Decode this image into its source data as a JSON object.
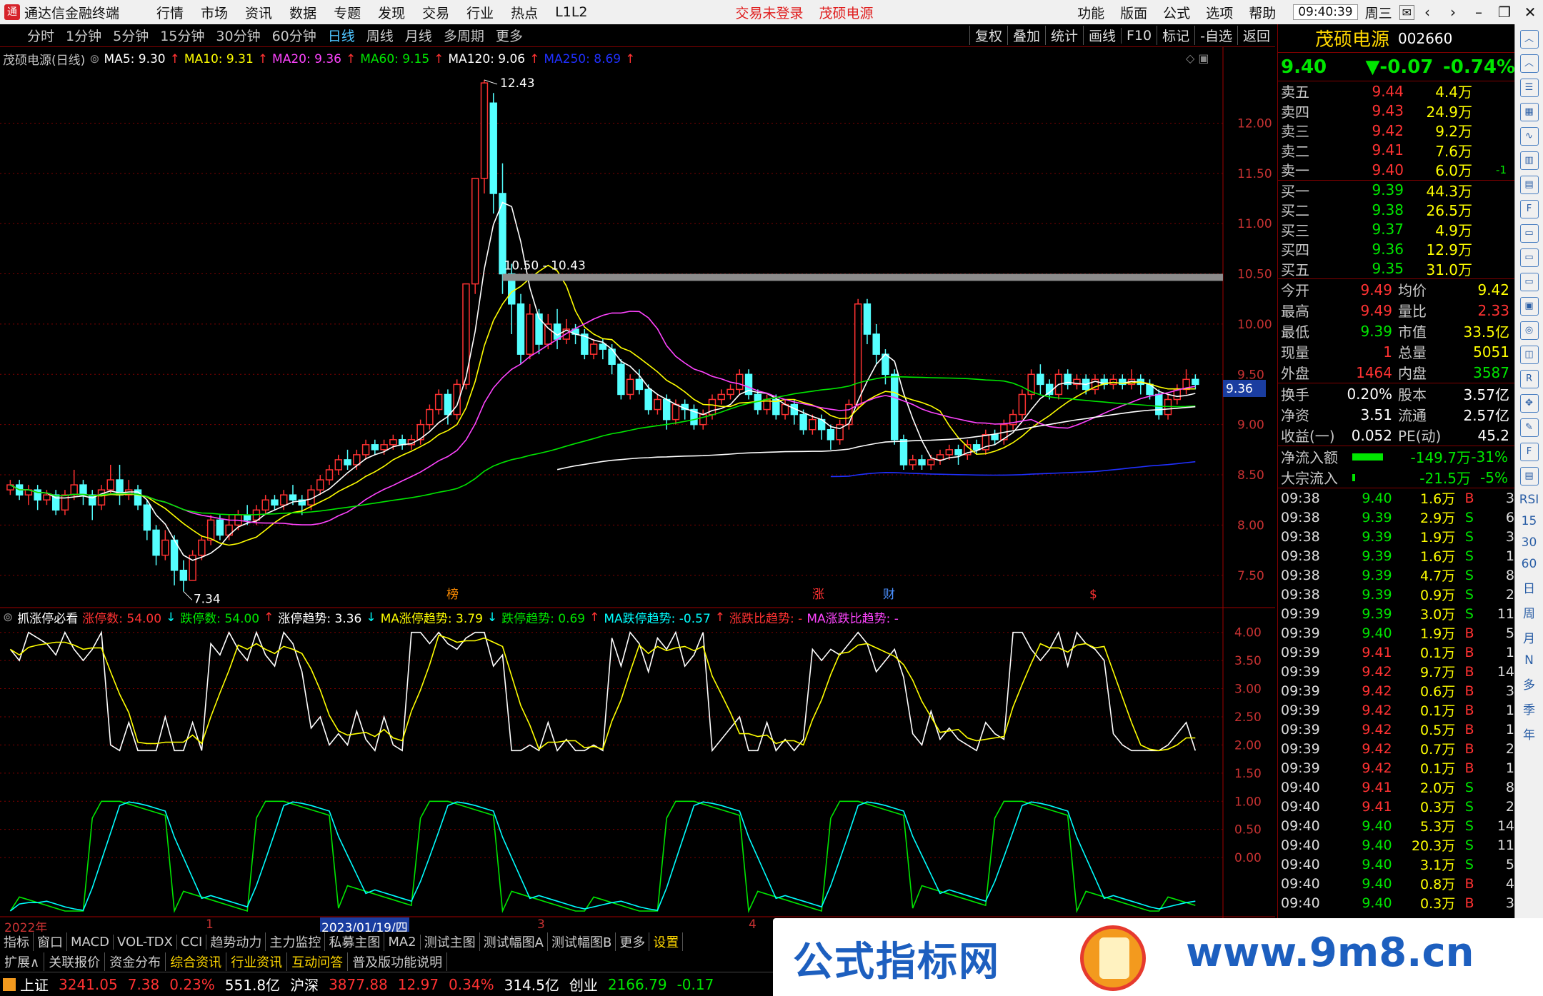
{
  "app": {
    "title": "通达信金融终端",
    "menus": [
      "行情",
      "市场",
      "资讯",
      "数据",
      "专题",
      "发现",
      "交易",
      "行业",
      "热点",
      "L1L2"
    ],
    "login": "交易未登录",
    "stock_title": "茂硕电源",
    "right_menus": [
      "功能",
      "版面",
      "公式",
      "选项",
      "帮助"
    ],
    "time": "09:40:39",
    "weekday": "周三"
  },
  "periods": [
    "分时",
    "1分钟",
    "5分钟",
    "15分钟",
    "30分钟",
    "60分钟",
    "日线",
    "周线",
    "月线",
    "多周期",
    "更多"
  ],
  "active_period": "日线",
  "tools": [
    "复权",
    "叠加",
    "统计",
    "画线",
    "F10",
    "标记",
    "-自选",
    "返回"
  ],
  "main": {
    "legend": {
      "name": "茂硕电源(日线)",
      "ma5": "MA5: 9.30",
      "ma10": "MA10: 9.31",
      "ma20": "MA20: 9.36",
      "ma60": "MA60: 9.15",
      "ma120": "MA120: 9.06",
      "ma250": "MA250: 8.69"
    },
    "price_labels": {
      "high": "12.43",
      "low": "7.34",
      "band": "10.50 - 10.43",
      "current": "9.36"
    },
    "axis": [
      "12.00",
      "11.50",
      "11.00",
      "10.50",
      "10.00",
      "9.50",
      "9.00",
      "8.50",
      "8.00",
      "7.50"
    ],
    "markers": [
      "榜",
      "涨",
      "财",
      "$"
    ]
  },
  "indicator": {
    "legend": {
      "name": "抓涨停必看",
      "zt": "涨停数: 54.00",
      "dt": "跌停数: 54.00",
      "ztqs": "涨停趋势: 3.36",
      "mazt": "MA涨停趋势: 3.79",
      "dtqs": "跌停趋势: 0.69",
      "madt": "MA跌停趋势: -0.57",
      "zdb": "涨跌比趋势: -",
      "mazdb": "MA涨跌比趋势: -"
    },
    "axis": [
      "4.00",
      "3.50",
      "3.00",
      "2.50",
      "2.00",
      "1.50",
      "1.00",
      "0.50",
      "0.00"
    ]
  },
  "date_axis": {
    "year": "2022年",
    "m1": "1",
    "cursor": "2023/01/19/四",
    "m3": "3",
    "m4": "4"
  },
  "quote": {
    "name": "茂硕电源",
    "code": "002660",
    "price": "9.40",
    "change": "▼-0.07",
    "pct": "-0.74%",
    "asks": [
      {
        "label": "卖五",
        "price": "9.44",
        "vol": "4.4万",
        "chg": ""
      },
      {
        "label": "卖四",
        "price": "9.43",
        "vol": "24.9万",
        "chg": ""
      },
      {
        "label": "卖三",
        "price": "9.42",
        "vol": "9.2万",
        "chg": ""
      },
      {
        "label": "卖二",
        "price": "9.41",
        "vol": "7.6万",
        "chg": ""
      },
      {
        "label": "卖一",
        "price": "9.40",
        "vol": "6.0万",
        "chg": "-1"
      }
    ],
    "bids": [
      {
        "label": "买一",
        "price": "9.39",
        "vol": "44.3万"
      },
      {
        "label": "买二",
        "price": "9.38",
        "vol": "26.5万"
      },
      {
        "label": "买三",
        "price": "9.37",
        "vol": "4.9万"
      },
      {
        "label": "买四",
        "price": "9.36",
        "vol": "12.9万"
      },
      {
        "label": "买五",
        "price": "9.35",
        "vol": "31.0万"
      }
    ],
    "stats1": [
      {
        "l1": "今开",
        "v1": "9.49",
        "l2": "均价",
        "v2": "9.42"
      },
      {
        "l1": "最高",
        "v1": "9.49",
        "l2": "量比",
        "v2": "2.33"
      },
      {
        "l1": "最低",
        "v1": "9.39",
        "l2": "市值",
        "v2": "33.5亿"
      },
      {
        "l1": "现量",
        "v1": "1",
        "l2": "总量",
        "v2": "5051"
      },
      {
        "l1": "外盘",
        "v1": "1464",
        "l2": "内盘",
        "v2": "3587"
      }
    ],
    "stats2": [
      {
        "l1": "换手",
        "v1": "0.20%",
        "l2": "股本",
        "v2": "3.57亿"
      },
      {
        "l1": "净资",
        "v1": "3.51",
        "l2": "流通",
        "v2": "2.57亿"
      },
      {
        "l1": "收益(一)",
        "v1": "0.052",
        "l2": "PE(动)",
        "v2": "45.2"
      }
    ],
    "flow": [
      {
        "label": "净流入额",
        "value": "-149.7万",
        "pct": "-31%",
        "bar": 0.62
      },
      {
        "label": "大宗流入",
        "value": "-21.5万",
        "pct": "-5%",
        "bar": 0.05
      }
    ],
    "ticks": [
      [
        "09:38",
        "9.40",
        "1.6万",
        "B",
        "3"
      ],
      [
        "09:38",
        "9.39",
        "2.9万",
        "S",
        "6"
      ],
      [
        "09:38",
        "9.39",
        "1.9万",
        "S",
        "3"
      ],
      [
        "09:38",
        "9.39",
        "1.6万",
        "S",
        "1"
      ],
      [
        "09:38",
        "9.39",
        "4.7万",
        "S",
        "8"
      ],
      [
        "09:38",
        "9.39",
        "0.9万",
        "S",
        "2"
      ],
      [
        "09:39",
        "9.39",
        "3.0万",
        "S",
        "11"
      ],
      [
        "09:39",
        "9.40",
        "1.9万",
        "B",
        "5"
      ],
      [
        "09:39",
        "9.41",
        "0.1万",
        "B",
        "1"
      ],
      [
        "09:39",
        "9.42",
        "9.7万",
        "B",
        "14"
      ],
      [
        "09:39",
        "9.42",
        "0.6万",
        "B",
        "3"
      ],
      [
        "09:39",
        "9.42",
        "0.1万",
        "B",
        "1"
      ],
      [
        "09:39",
        "9.42",
        "0.5万",
        "B",
        "1"
      ],
      [
        "09:39",
        "9.42",
        "0.7万",
        "B",
        "2"
      ],
      [
        "09:39",
        "9.42",
        "0.1万",
        "B",
        "1"
      ],
      [
        "09:40",
        "9.41",
        "2.0万",
        "S",
        "8"
      ],
      [
        "09:40",
        "9.41",
        "0.3万",
        "S",
        "2"
      ],
      [
        "09:40",
        "9.40",
        "5.3万",
        "S",
        "14"
      ],
      [
        "09:40",
        "9.40",
        "20.3万",
        "S",
        "11"
      ],
      [
        "09:40",
        "9.40",
        "3.1万",
        "S",
        "5"
      ],
      [
        "09:40",
        "9.40",
        "0.8万",
        "B",
        "4"
      ],
      [
        "09:40",
        "9.40",
        "0.3万",
        "B",
        "3"
      ]
    ]
  },
  "strip": {
    "icons": [
      "chevron-up-icon",
      "chevron-up-icon",
      "list-icon",
      "grid-icon",
      "line-icon",
      "bar-icon",
      "table-icon",
      "f10-icon",
      "doc-icon",
      "doc-icon",
      "doc-icon",
      "box-icon",
      "ring-icon",
      "chart-icon",
      "rsi-icon",
      "move-icon",
      "pen-icon",
      "fs-icon",
      "tab-icon"
    ],
    "labels": [
      "RSI",
      "15",
      "30",
      "60",
      "日",
      "周",
      "月",
      "N",
      "多",
      "季",
      "年"
    ]
  },
  "tabs1": [
    "指标",
    "窗口",
    "MACD",
    "VOL-TDX",
    "CCI",
    "趋势动力",
    "主力监控",
    "私募主图",
    "MA2",
    "测试主图",
    "测试幅图A",
    "测试幅图B",
    "更多",
    "设置"
  ],
  "tabs2": [
    "扩展∧",
    "关联报价",
    "资金分布",
    "综合资讯",
    "行业资讯",
    "互动问答",
    "普及版功能说明"
  ],
  "status": [
    {
      "name": "上证",
      "v": "3241.05",
      "c": "7.38",
      "p": "0.23%",
      "amt": "551.8亿"
    },
    {
      "name": "沪深",
      "v": "3877.88",
      "c": "12.97",
      "p": "0.34%",
      "amt": "314.5亿"
    },
    {
      "name": "创业",
      "v": "2166.79",
      "c": "-0.17",
      "p": "",
      "amt": ""
    }
  ],
  "watermark": {
    "left": "公式指标网",
    "right": "www.9m8.cn"
  },
  "colors": {
    "up": "#ff3232",
    "down": "#54ffff",
    "ma5": "#ffffff",
    "ma10": "#ffff00",
    "ma20": "#ff44ff",
    "ma60": "#00e600",
    "ma120": "#ffffff",
    "ma250": "#2030ff",
    "grid": "#800000"
  },
  "chart_data": {
    "type": "candlestick",
    "ylim": [
      7.2,
      12.6
    ],
    "candles": [
      [
        8.35,
        8.4,
        8.3,
        8.45
      ],
      [
        8.4,
        8.3,
        8.25,
        8.45
      ],
      [
        8.3,
        8.35,
        8.2,
        8.4
      ],
      [
        8.35,
        8.25,
        8.15,
        8.4
      ],
      [
        8.25,
        8.3,
        8.2,
        8.35
      ],
      [
        8.3,
        8.15,
        8.1,
        8.35
      ],
      [
        8.15,
        8.3,
        8.1,
        8.35
      ],
      [
        8.3,
        8.4,
        8.25,
        8.55
      ],
      [
        8.4,
        8.3,
        8.2,
        8.45
      ],
      [
        8.3,
        8.2,
        8.05,
        8.35
      ],
      [
        8.2,
        8.35,
        8.15,
        8.4
      ],
      [
        8.35,
        8.45,
        8.3,
        8.6
      ],
      [
        8.45,
        8.3,
        8.2,
        8.6
      ],
      [
        8.3,
        8.35,
        8.25,
        8.45
      ],
      [
        8.35,
        8.2,
        8.15,
        8.4
      ],
      [
        8.2,
        7.95,
        7.85,
        8.25
      ],
      [
        7.95,
        7.7,
        7.6,
        8.0
      ],
      [
        7.7,
        7.85,
        7.65,
        7.95
      ],
      [
        7.85,
        7.55,
        7.4,
        7.9
      ],
      [
        7.55,
        7.45,
        7.34,
        7.65
      ],
      [
        7.45,
        7.7,
        7.45,
        7.75
      ],
      [
        7.7,
        7.85,
        7.65,
        7.9
      ],
      [
        7.85,
        8.05,
        7.8,
        8.1
      ],
      [
        8.05,
        7.9,
        7.85,
        8.1
      ],
      [
        7.9,
        8.0,
        7.85,
        8.1
      ],
      [
        8.0,
        8.1,
        7.95,
        8.15
      ],
      [
        8.1,
        8.05,
        8.0,
        8.2
      ],
      [
        8.05,
        8.15,
        8.0,
        8.2
      ],
      [
        8.15,
        8.25,
        8.1,
        8.3
      ],
      [
        8.25,
        8.2,
        8.15,
        8.3
      ],
      [
        8.2,
        8.3,
        8.15,
        8.35
      ],
      [
        8.3,
        8.25,
        8.2,
        8.4
      ],
      [
        8.25,
        8.2,
        8.1,
        8.3
      ],
      [
        8.2,
        8.35,
        8.15,
        8.4
      ],
      [
        8.35,
        8.45,
        8.3,
        8.5
      ],
      [
        8.45,
        8.55,
        8.4,
        8.6
      ],
      [
        8.55,
        8.65,
        8.5,
        8.7
      ],
      [
        8.65,
        8.6,
        8.55,
        8.75
      ],
      [
        8.6,
        8.7,
        8.55,
        8.75
      ],
      [
        8.7,
        8.8,
        8.65,
        8.85
      ],
      [
        8.8,
        8.75,
        8.7,
        8.85
      ],
      [
        8.75,
        8.8,
        8.7,
        8.85
      ],
      [
        8.8,
        8.85,
        8.75,
        8.9
      ],
      [
        8.85,
        8.8,
        8.75,
        8.9
      ],
      [
        8.8,
        8.85,
        8.75,
        8.9
      ],
      [
        8.85,
        9.0,
        8.8,
        9.05
      ],
      [
        9.0,
        9.15,
        8.95,
        9.2
      ],
      [
        9.15,
        9.3,
        9.1,
        9.35
      ],
      [
        9.3,
        9.1,
        9.0,
        9.35
      ],
      [
        9.1,
        9.4,
        9.05,
        9.45
      ],
      [
        9.4,
        10.4,
        9.35,
        10.4
      ],
      [
        10.4,
        11.45,
        10.3,
        11.45
      ],
      [
        11.45,
        12.4,
        11.3,
        12.43
      ],
      [
        12.2,
        11.3,
        11.1,
        12.3
      ],
      [
        11.3,
        10.5,
        10.3,
        11.6
      ],
      [
        10.5,
        10.2,
        9.9,
        10.6
      ],
      [
        10.2,
        9.7,
        9.6,
        10.3
      ],
      [
        9.7,
        10.1,
        9.65,
        10.2
      ],
      [
        10.1,
        9.8,
        9.7,
        10.15
      ],
      [
        9.8,
        10.0,
        9.75,
        10.1
      ],
      [
        10.0,
        9.85,
        9.75,
        10.15
      ],
      [
        9.85,
        9.95,
        9.8,
        10.05
      ],
      [
        9.95,
        9.9,
        9.8,
        10.0
      ],
      [
        9.9,
        9.7,
        9.65,
        9.95
      ],
      [
        9.7,
        9.8,
        9.65,
        9.85
      ],
      [
        9.8,
        9.75,
        9.65,
        9.85
      ],
      [
        9.75,
        9.6,
        9.5,
        9.8
      ],
      [
        9.6,
        9.3,
        9.25,
        9.65
      ],
      [
        9.3,
        9.45,
        9.25,
        9.5
      ],
      [
        9.45,
        9.35,
        9.3,
        9.55
      ],
      [
        9.35,
        9.15,
        9.1,
        9.4
      ],
      [
        9.15,
        9.25,
        9.1,
        9.3
      ],
      [
        9.25,
        9.05,
        8.95,
        9.3
      ],
      [
        9.05,
        9.2,
        9.0,
        9.25
      ],
      [
        9.2,
        9.15,
        9.05,
        9.25
      ],
      [
        9.15,
        9.0,
        8.95,
        9.2
      ],
      [
        9.0,
        9.1,
        8.95,
        9.15
      ],
      [
        9.1,
        9.25,
        9.05,
        9.3
      ],
      [
        9.25,
        9.3,
        9.2,
        9.35
      ],
      [
        9.3,
        9.35,
        9.25,
        9.4
      ],
      [
        9.35,
        9.5,
        9.3,
        9.55
      ],
      [
        9.5,
        9.3,
        9.25,
        9.55
      ],
      [
        9.3,
        9.15,
        9.1,
        9.35
      ],
      [
        9.15,
        9.25,
        9.1,
        9.3
      ],
      [
        9.25,
        9.1,
        9.05,
        9.3
      ],
      [
        9.1,
        9.2,
        9.05,
        9.25
      ],
      [
        9.2,
        9.1,
        9.0,
        9.25
      ],
      [
        9.1,
        8.95,
        8.9,
        9.15
      ],
      [
        8.95,
        9.05,
        8.9,
        9.1
      ],
      [
        9.05,
        8.95,
        8.85,
        9.1
      ],
      [
        8.95,
        8.85,
        8.75,
        9.0
      ],
      [
        8.85,
        9.0,
        8.8,
        9.05
      ],
      [
        9.0,
        9.2,
        8.95,
        9.25
      ],
      [
        9.2,
        10.2,
        9.15,
        10.25
      ],
      [
        10.2,
        9.9,
        9.8,
        10.25
      ],
      [
        9.9,
        9.7,
        9.6,
        10.0
      ],
      [
        9.7,
        9.5,
        9.4,
        9.75
      ],
      [
        9.5,
        8.85,
        8.8,
        9.55
      ],
      [
        8.85,
        8.6,
        8.55,
        8.9
      ],
      [
        8.6,
        8.65,
        8.55,
        8.7
      ],
      [
        8.65,
        8.6,
        8.55,
        8.7
      ],
      [
        8.6,
        8.65,
        8.55,
        8.7
      ],
      [
        8.65,
        8.7,
        8.6,
        8.75
      ],
      [
        8.7,
        8.75,
        8.65,
        8.8
      ],
      [
        8.75,
        8.7,
        8.6,
        8.8
      ],
      [
        8.7,
        8.8,
        8.65,
        8.85
      ],
      [
        8.8,
        8.75,
        8.7,
        8.85
      ],
      [
        8.75,
        8.9,
        8.7,
        8.95
      ],
      [
        8.9,
        8.85,
        8.8,
        8.95
      ],
      [
        8.85,
        9.0,
        8.8,
        9.05
      ],
      [
        9.0,
        9.1,
        8.95,
        9.15
      ],
      [
        9.1,
        9.3,
        9.05,
        9.35
      ],
      [
        9.3,
        9.5,
        9.25,
        9.55
      ],
      [
        9.5,
        9.4,
        9.3,
        9.6
      ],
      [
        9.4,
        9.3,
        9.25,
        9.45
      ],
      [
        9.3,
        9.5,
        9.25,
        9.55
      ],
      [
        9.5,
        9.4,
        9.35,
        9.55
      ],
      [
        9.4,
        9.45,
        9.35,
        9.5
      ],
      [
        9.45,
        9.35,
        9.3,
        9.5
      ],
      [
        9.35,
        9.45,
        9.3,
        9.5
      ],
      [
        9.45,
        9.4,
        9.35,
        9.5
      ],
      [
        9.4,
        9.45,
        9.35,
        9.5
      ],
      [
        9.45,
        9.4,
        9.35,
        9.5
      ],
      [
        9.4,
        9.45,
        9.35,
        9.55
      ],
      [
        9.45,
        9.4,
        9.3,
        9.5
      ],
      [
        9.4,
        9.3,
        9.25,
        9.45
      ],
      [
        9.3,
        9.1,
        9.05,
        9.35
      ],
      [
        9.1,
        9.25,
        9.05,
        9.3
      ],
      [
        9.25,
        9.35,
        9.2,
        9.4
      ],
      [
        9.35,
        9.45,
        9.3,
        9.55
      ],
      [
        9.45,
        9.4,
        9.35,
        9.5
      ]
    ]
  }
}
